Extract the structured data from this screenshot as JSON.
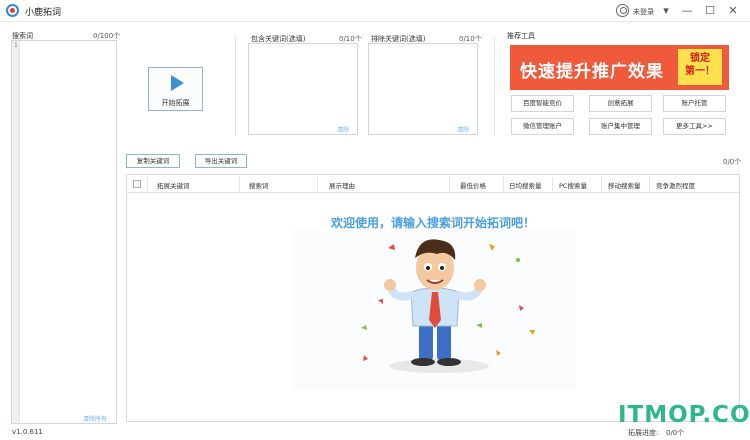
{
  "window": {
    "title": "小鹿拓词",
    "user_label": "未登录",
    "minimize": "—",
    "maximize": "☐",
    "close": "✕",
    "dropdown": "▾"
  },
  "left_panel": {
    "label": "搜索词",
    "count": "0/100个",
    "line_number": "1",
    "clear": "清除所有"
  },
  "start_button": {
    "label": "开始拓展"
  },
  "include_box": {
    "label": "包含关键词(选填)",
    "count": "0/10个",
    "clear": "清除"
  },
  "exclude_box": {
    "label": "排除关键词(选填)",
    "count": "0/10个",
    "clear": "清除"
  },
  "tools": {
    "label": "推荐工具",
    "promo_main": "快速提升推广效果",
    "promo_badge_line1": "锁定",
    "promo_badge_line2": "第一！",
    "buttons": [
      "百度智能竞价",
      "创意拓展",
      "账户托管",
      "微信管理账户",
      "账户集中管理",
      "更多工具>>"
    ]
  },
  "actions": {
    "copy": "复制关键词",
    "export": "导出关键词",
    "count": "0/0个"
  },
  "table": {
    "columns": [
      "拓展关键词",
      "搜索词",
      "展示理由",
      "最低价格",
      "日均搜索量",
      "PC搜索量",
      "移动搜索量",
      "竞争激烈程度"
    ],
    "welcome": "欢迎使用，请输入搜索词开始拓词吧！"
  },
  "footer": {
    "version": "v1.0.611",
    "progress_label": "拓展进度:",
    "progress_value": "0/0个"
  },
  "watermark": "ITMOP.COM",
  "colors": {
    "accent": "#3d8fd4",
    "promo_bg": "#ef5a3a",
    "promo_badge": "#ffe14d",
    "welcome_text": "#4a9ee0",
    "watermark": "#2eb88a"
  }
}
